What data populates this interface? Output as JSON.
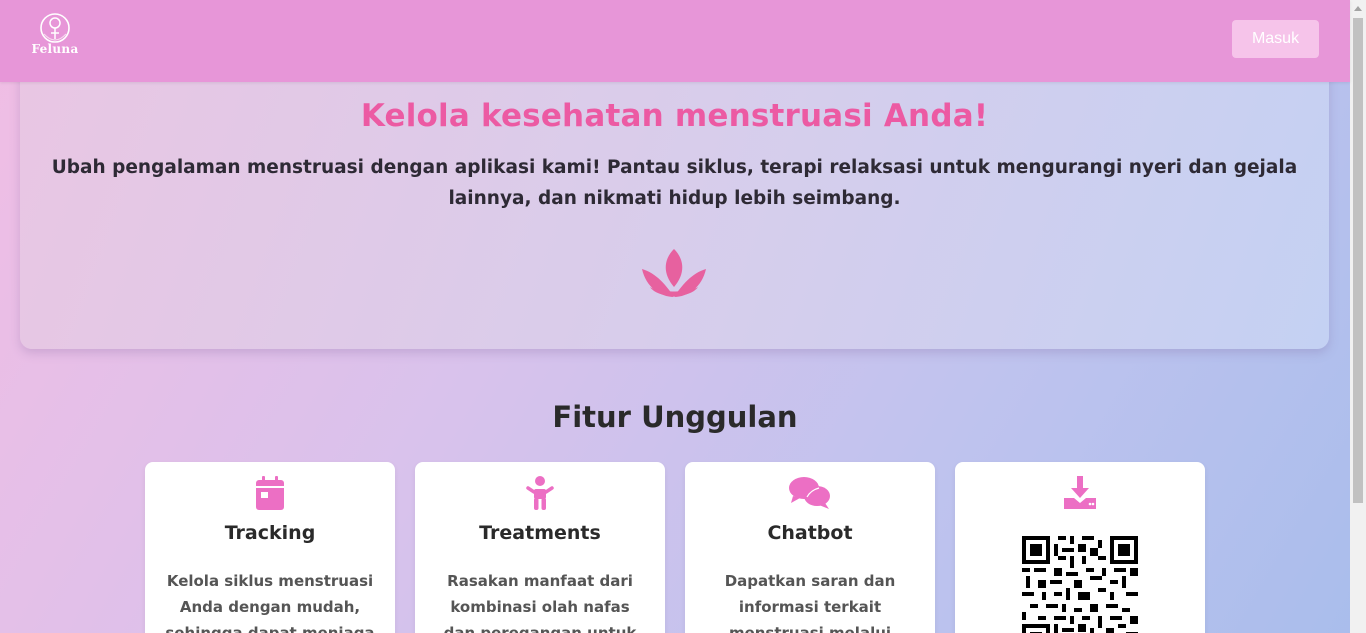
{
  "nav": {
    "logo_text": "Feluna",
    "login_label": "Masuk"
  },
  "hero": {
    "title": "Kelola kesehatan menstruasi Anda!",
    "subtitle": "Ubah pengalaman menstruasi dengan aplikasi kami! Pantau siklus, terapi relaksasi untuk mengurangi nyeri dan gejala lainnya, dan nikmati hidup lebih seimbang.",
    "icon": "lotus-icon"
  },
  "features": {
    "title": "Fitur Unggulan",
    "cards": [
      {
        "icon": "calendar-icon",
        "title": "Tracking",
        "desc": "Kelola siklus menstruasi Anda dengan mudah, sehingga dapat menjaga"
      },
      {
        "icon": "child-icon",
        "title": "Treatments",
        "desc": "Rasakan manfaat dari kombinasi olah nafas dan peregangan untuk"
      },
      {
        "icon": "comments-icon",
        "title": "Chatbot",
        "desc": "Dapatkan saran dan informasi terkait menstruasi melalui"
      },
      {
        "icon": "download-icon",
        "title": "",
        "desc": ""
      }
    ]
  },
  "colors": {
    "accent": "#ec5aa3",
    "navbar": "#e796d8",
    "icon": "#ec6fc4"
  }
}
